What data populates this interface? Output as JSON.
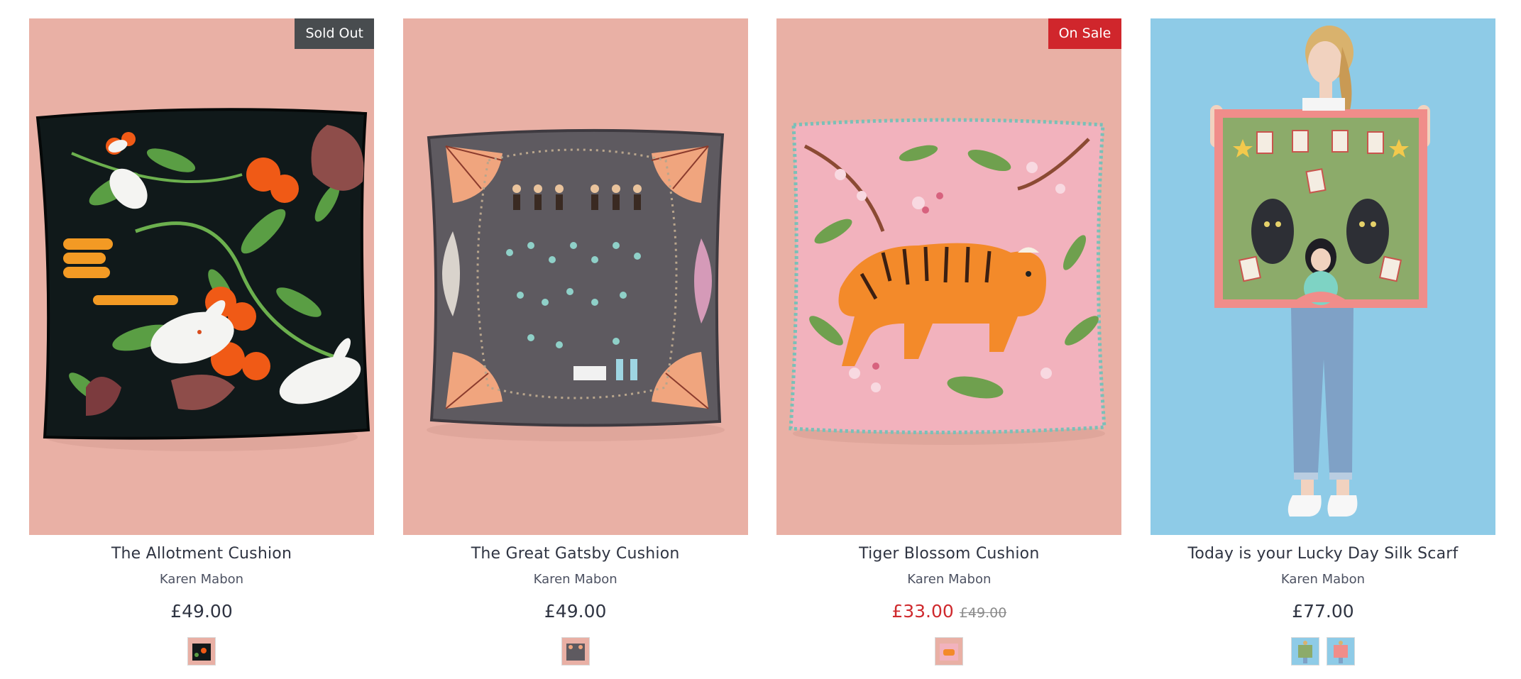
{
  "products": [
    {
      "title": "The Allotment Cushion",
      "vendor": "Karen Mabon",
      "price": "£49.00",
      "compare_price": "",
      "badge": "Sold Out",
      "badge_type": "sold",
      "background": "#e9b0a5",
      "swatch_count": 1
    },
    {
      "title": "The Great Gatsby Cushion",
      "vendor": "Karen Mabon",
      "price": "£49.00",
      "compare_price": "",
      "badge": "",
      "badge_type": "",
      "background": "#e9b0a5",
      "swatch_count": 1
    },
    {
      "title": "Tiger Blossom Cushion",
      "vendor": "Karen Mabon",
      "price": "£33.00",
      "compare_price": "£49.00",
      "badge": "On Sale",
      "badge_type": "sale",
      "background": "#e9b0a5",
      "swatch_count": 1
    },
    {
      "title": "Today is your Lucky Day Silk Scarf",
      "vendor": "Karen Mabon",
      "price": "£77.00",
      "compare_price": "",
      "badge": "",
      "badge_type": "",
      "background": "#8ecbe7",
      "swatch_count": 2
    }
  ],
  "colors": {
    "sold_badge": "#484c4f",
    "sale_badge": "#d0262c",
    "sale_price": "#cf2a2e",
    "cushion_background": "#e9b0a5",
    "scarf_background": "#8ecbe7"
  },
  "icons": [
    "cushion-allotment-image",
    "cushion-gatsby-image",
    "cushion-tiger-image",
    "scarf-lucky-day-image"
  ]
}
